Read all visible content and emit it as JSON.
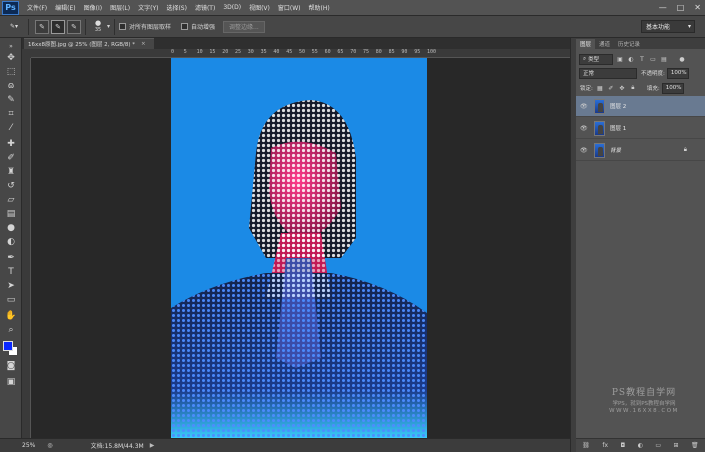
{
  "app": {
    "logo": "Ps"
  },
  "menu": [
    "文件(F)",
    "编辑(E)",
    "图像(I)",
    "图层(L)",
    "文字(Y)",
    "选择(S)",
    "滤镜(T)",
    "3D(D)",
    "视图(V)",
    "窗口(W)",
    "帮助(H)"
  ],
  "window_controls": {
    "minimize": "—",
    "maximize": "□",
    "close": "✕"
  },
  "options_bar": {
    "brush_size": "35",
    "sample_all_layers": "对所有图层取样",
    "auto_enhance": "自动增强",
    "refine_edge": "调整边缘...",
    "workspace": "基本功能"
  },
  "document": {
    "tab_title": "16xx8原图.jpg @ 25% (图层 2, RGB/8) *",
    "close": "×",
    "ruler_ticks": [
      "0",
      "5",
      "10",
      "15",
      "20",
      "25",
      "30",
      "35",
      "40",
      "45",
      "50",
      "55",
      "60",
      "65",
      "70",
      "75",
      "80",
      "85",
      "90",
      "95",
      "100"
    ],
    "background_color": "#1b8ae6"
  },
  "status_bar": {
    "zoom": "25%",
    "doc_info": "文档:15.8M/44.3M",
    "arrow": "▶"
  },
  "layers_panel": {
    "tabs": [
      "图层",
      "通道",
      "历史记录"
    ],
    "filter_kind": "类型",
    "blend_mode": "正常",
    "opacity_label": "不透明度:",
    "opacity_value": "100%",
    "lock_label": "锁定:",
    "fill_label": "填充:",
    "fill_value": "100%",
    "layers": [
      {
        "name": "图层 2",
        "selected": true,
        "italic": false,
        "locked": false
      },
      {
        "name": "图层 1",
        "selected": false,
        "italic": false,
        "locked": false
      },
      {
        "name": "背景",
        "selected": false,
        "italic": true,
        "locked": true
      }
    ],
    "footer_icons": [
      "link-icon",
      "fx-icon",
      "mask-icon",
      "adjustment-icon",
      "group-icon",
      "new-layer-icon",
      "trash-icon"
    ]
  },
  "watermark": {
    "title": "PS教程自学网",
    "subtitle": "学PS，就到PS教程自学网",
    "url": "WWW.16XX8.COM"
  },
  "colors": {
    "foreground": "#0a28ff",
    "background": "#ffffff",
    "selected_layer": "#697a91"
  },
  "tools": [
    "move-tool-icon",
    "marquee-tool-icon",
    "lasso-tool-icon",
    "quick-select-tool-icon",
    "crop-tool-icon",
    "eyedropper-tool-icon",
    "healing-brush-tool-icon",
    "brush-tool-icon",
    "clone-stamp-tool-icon",
    "history-brush-tool-icon",
    "eraser-tool-icon",
    "gradient-tool-icon",
    "blur-tool-icon",
    "dodge-tool-icon",
    "pen-tool-icon",
    "type-tool-icon",
    "path-select-tool-icon",
    "shape-tool-icon",
    "hand-tool-icon",
    "zoom-tool-icon"
  ]
}
